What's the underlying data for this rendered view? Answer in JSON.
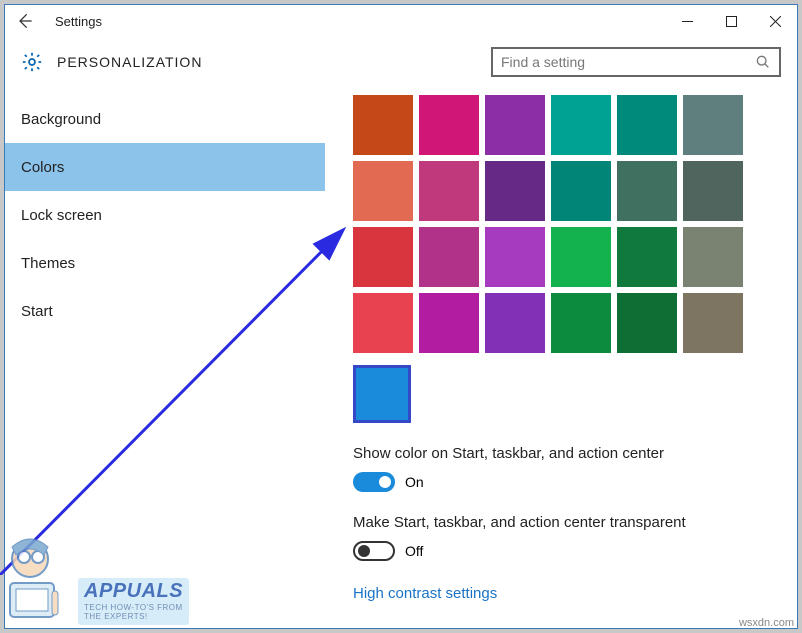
{
  "window": {
    "title": "Settings"
  },
  "header": {
    "heading": "PERSONALIZATION"
  },
  "search": {
    "placeholder": "Find a setting"
  },
  "sidebar": {
    "items": [
      {
        "label": "Background"
      },
      {
        "label": "Colors"
      },
      {
        "label": "Lock screen"
      },
      {
        "label": "Themes"
      },
      {
        "label": "Start"
      }
    ],
    "activeIndex": 1
  },
  "colors": {
    "rows": [
      [
        "#c54819",
        "#d01676",
        "#8c2fa6",
        "#00a294",
        "#008a7c",
        "#5f7f7e"
      ],
      [
        "#e26a53",
        "#c0397c",
        "#662a86",
        "#008577",
        "#3f7060",
        "#51655f"
      ],
      [
        "#d8353f",
        "#b03289",
        "#a63bbf",
        "#13b24e",
        "#107a3e",
        "#7a8272"
      ],
      [
        "#e84150",
        "#b11ca0",
        "#8230b5",
        "#0c8a3e",
        "#0e6e34",
        "#7d7562"
      ]
    ],
    "selected": "#1a8adb"
  },
  "settings": {
    "showColor": {
      "label": "Show color on Start, taskbar, and action center",
      "state": "On",
      "on": true
    },
    "transparent": {
      "label": "Make Start, taskbar, and action center transparent",
      "state": "Off",
      "on": false
    },
    "link": "High contrast settings"
  },
  "branding": {
    "name": "APPUALS",
    "tag1": "TECH HOW-TO'S FROM",
    "tag2": "THE EXPERTS!"
  },
  "watermark": "wsxdn.com"
}
